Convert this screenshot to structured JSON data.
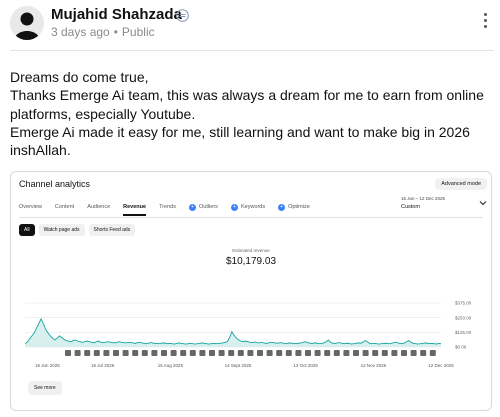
{
  "post": {
    "author": "Mujahid Shahzada",
    "time": "3 days ago",
    "visibility": "Public",
    "lines": [
      "Dreams do come true,",
      "Thanks Emerge Ai team, this was always a dream for me to earn from online platforms, especially Youtube.",
      "Emerge Ai made it easy for me, still learning and want to make big in 2026 inshAllah."
    ]
  },
  "analytics": {
    "title": "Channel analytics",
    "advanced_mode": "Advanced mode",
    "tabs": [
      {
        "label": "Overview"
      },
      {
        "label": "Content"
      },
      {
        "label": "Audience"
      },
      {
        "label": "Revenue"
      },
      {
        "label": "Trends"
      },
      {
        "label": "Outliers"
      },
      {
        "label": "Keywords"
      },
      {
        "label": "Optimize"
      }
    ],
    "active_tab": "Revenue",
    "date_range": "16 Jun – 12 Dec 2025",
    "date_mode": "Custom",
    "filters": [
      "All",
      "Watch page ads",
      "Shorts Feed ads"
    ],
    "selected_filter": "All",
    "metric_label": "Estimated revenue",
    "metric_value": "$10,179.03",
    "see_more": "See more",
    "accent_color": "#16a3a0"
  },
  "chart_data": {
    "type": "area",
    "title": "",
    "ylabel": "",
    "y_ticks": [
      "$375.00",
      "$250.00",
      "$125.00",
      "$0.00"
    ],
    "y_tick_values": [
      375,
      250,
      125,
      0
    ],
    "ylim": [
      0,
      375
    ],
    "x_ticks": [
      "16 Jun 2025",
      "16 Jul 2025",
      "15 Aug 2025",
      "14 Sept 2025",
      "13 Oct 2025",
      "12 Nov 2025",
      "12 Dec 2025"
    ],
    "x_start": "16 Jun 2025",
    "x_end": "12 Dec 2025",
    "grid": true,
    "values": [
      30,
      40,
      70,
      95,
      120,
      160,
      200,
      240,
      200,
      150,
      120,
      95,
      75,
      60,
      75,
      95,
      80,
      65,
      55,
      50,
      45,
      55,
      60,
      50,
      45,
      40,
      45,
      50,
      45,
      40,
      35,
      45,
      50,
      40,
      38,
      40,
      45,
      42,
      38,
      35,
      40,
      45,
      40,
      38,
      35,
      40,
      38,
      35,
      30,
      38,
      40,
      35,
      30,
      28,
      35,
      38,
      32,
      30,
      28,
      30,
      35,
      32,
      28,
      30,
      28,
      25,
      30,
      35,
      30,
      28,
      25,
      28,
      30,
      28,
      25,
      28,
      30,
      35,
      30,
      28,
      25,
      28,
      30,
      28,
      30,
      32,
      35,
      40,
      45,
      80,
      130,
      100,
      75,
      60,
      50,
      45,
      50,
      45,
      40,
      38,
      42,
      38,
      35,
      40,
      35,
      30,
      35,
      40,
      38,
      35,
      32,
      38,
      35,
      30,
      28,
      35,
      32,
      30,
      28,
      32,
      35,
      40,
      45,
      38,
      32,
      30,
      35,
      32,
      28,
      30,
      35,
      45,
      60,
      40,
      32,
      30,
      35,
      38,
      30,
      28,
      32,
      30,
      25,
      28,
      30,
      35,
      32,
      40,
      55,
      45,
      30,
      28,
      30,
      28,
      25,
      28,
      30,
      32,
      28,
      30,
      35,
      40,
      38,
      30,
      28,
      32,
      45,
      55,
      40,
      30,
      28,
      25,
      28,
      30,
      35,
      32,
      28,
      30,
      28,
      25,
      30,
      28
    ]
  }
}
